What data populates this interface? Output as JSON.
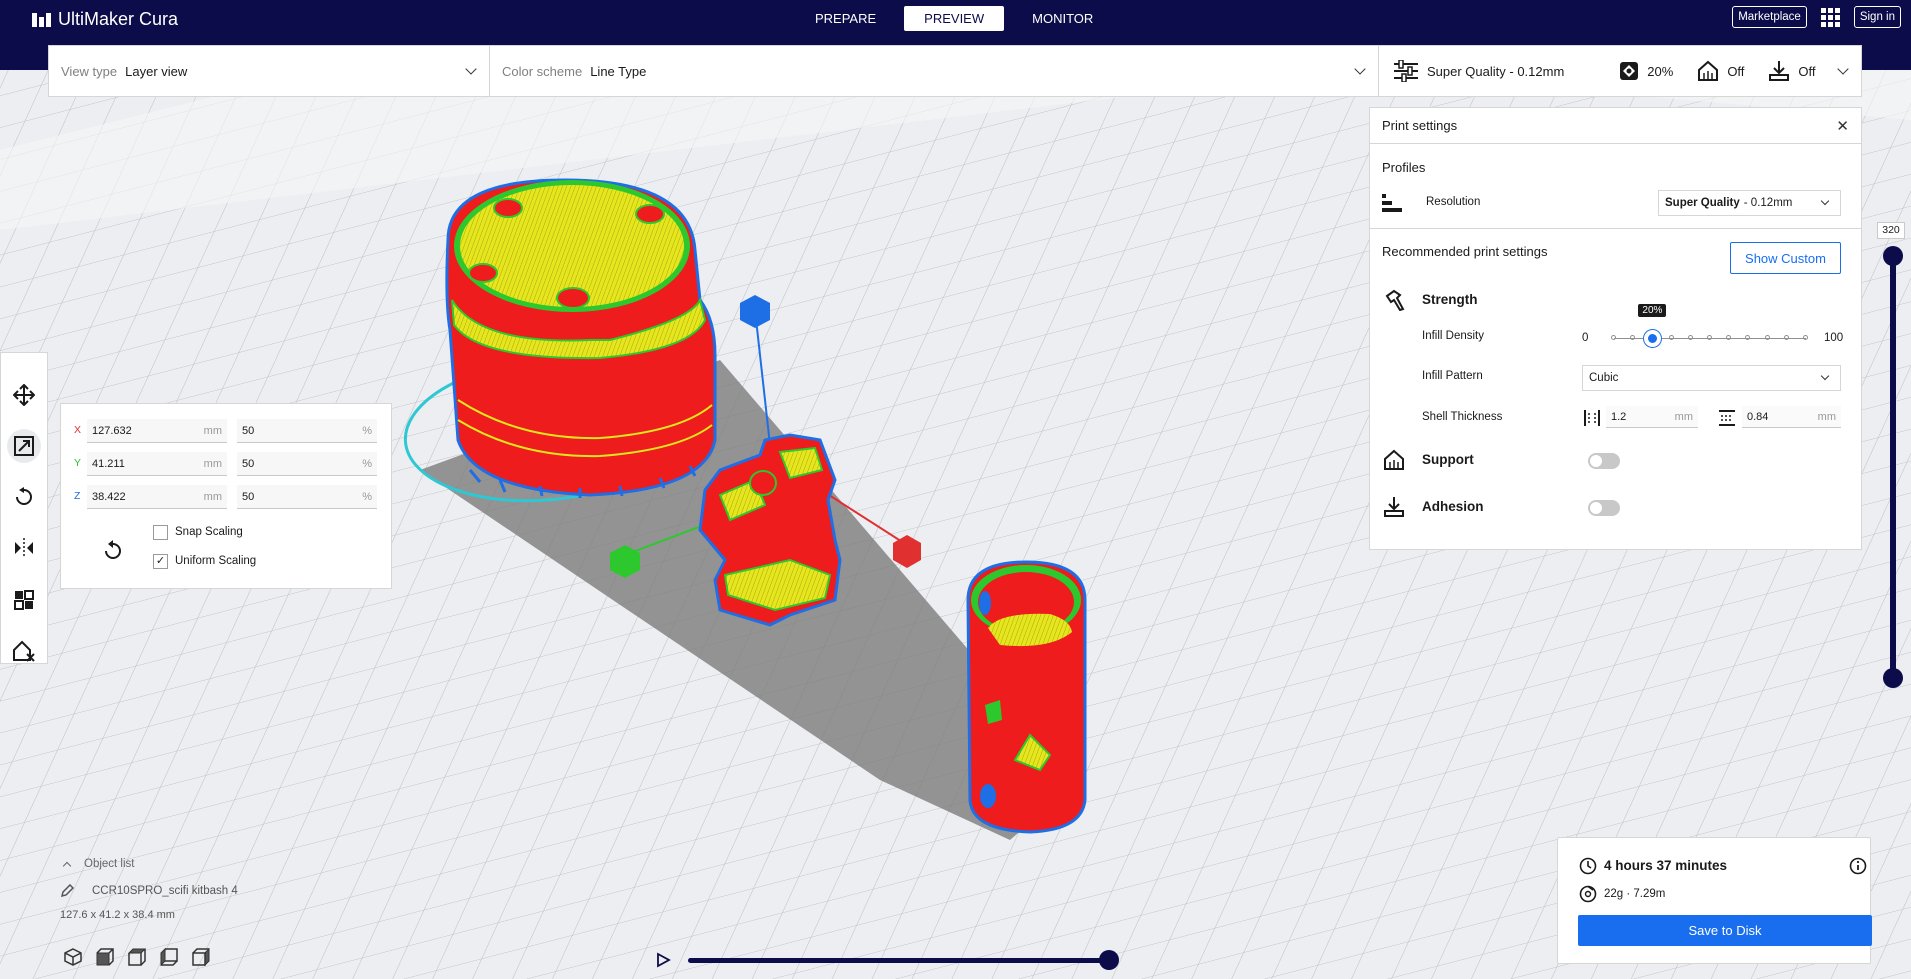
{
  "app": {
    "name": "UltiMaker Cura"
  },
  "header": {
    "stages": [
      {
        "label": "PREPARE",
        "active": false
      },
      {
        "label": "PREVIEW",
        "active": true
      },
      {
        "label": "MONITOR",
        "active": false
      }
    ],
    "marketplace_label": "Marketplace",
    "sign_in_label": "Sign in"
  },
  "view_bar": {
    "view_type_label": "View type",
    "view_type_value": "Layer view",
    "color_scheme_label": "Color scheme",
    "color_scheme_value": "Line Type",
    "profile_summary": "Super Quality - 0.12mm",
    "infill_summary": "20%",
    "support_summary": "Off",
    "adhesion_summary": "Off"
  },
  "print_settings": {
    "title": "Print settings",
    "profiles_label": "Profiles",
    "resolution_label": "Resolution",
    "resolution_bold": "Super Quality",
    "resolution_rest": "- 0.12mm",
    "recommended_label": "Recommended print settings",
    "show_custom_label": "Show Custom",
    "strength_label": "Strength",
    "infill_density_label": "Infill Density",
    "infill_min": "0",
    "infill_max": "100",
    "infill_value_label": "20%",
    "infill_density": 20,
    "infill_pattern_label": "Infill Pattern",
    "infill_pattern_value": "Cubic",
    "shell_thickness_label": "Shell Thickness",
    "wall_thickness_value": "1.2",
    "top_bottom_thickness_value": "0.84",
    "unit_mm": "mm",
    "support_label": "Support",
    "support_enabled": false,
    "adhesion_label": "Adhesion",
    "adhesion_enabled": false
  },
  "scale_tool": {
    "x_label": "X",
    "y_label": "Y",
    "z_label": "Z",
    "x_mm": "127.632",
    "y_mm": "41.211",
    "z_mm": "38.422",
    "x_pct": "50",
    "y_pct": "50",
    "z_pct": "50",
    "unit_mm": "mm",
    "unit_pct": "%",
    "snap_scaling_label": "Snap Scaling",
    "snap_scaling_checked": false,
    "uniform_scaling_label": "Uniform Scaling",
    "uniform_scaling_checked": true
  },
  "object_list": {
    "toggle_label": "Object list",
    "object_name": "CCR10SPRO_scifi kitbash 4",
    "dimensions": "127.6 x 41.2 x 38.4 mm"
  },
  "layer_slider": {
    "max_layer": "320"
  },
  "estimate": {
    "time": "4 hours 37 minutes",
    "material": "22g · 7.29m",
    "save_label": "Save to Disk"
  },
  "colors": {
    "header_bg": "#0c0c4a",
    "accent_blue": "#196ef0",
    "model_red": "#ee1c1c",
    "infill_yellow": "#e6e61e",
    "wall_green": "#2dc82d",
    "shell_blue": "#1e6ee6",
    "travel_cyan": "#2ec8d4"
  },
  "icons": {
    "move": "move-icon",
    "scale": "scale-icon",
    "rotate": "rotate-icon",
    "mirror": "mirror-icon",
    "per_model": "per-model-settings-icon",
    "support_blocker": "support-blocker-icon"
  }
}
